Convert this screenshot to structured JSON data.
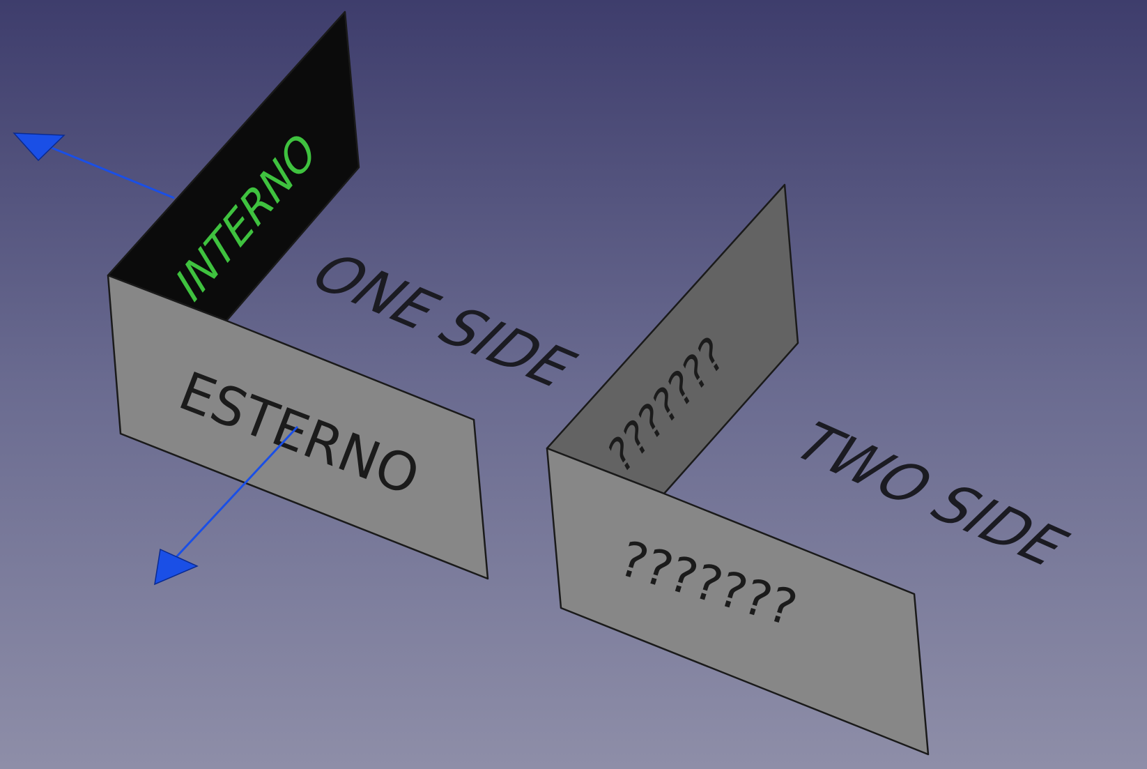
{
  "scene": {
    "background_top": "#3e3d6c",
    "background_bottom": "#8e8ea8",
    "arrow_color": "#1a4fe6",
    "one_side": {
      "title": "ONE SIDE",
      "inner_label": "INTERNO",
      "outer_label": "ESTERNO",
      "inner_face_color": "#0b0b0b",
      "outer_face_color": "#878787",
      "inner_label_color": "#3fc23f"
    },
    "two_side": {
      "title": "TWO SIDE",
      "inner_label": "???????",
      "outer_label": "???????",
      "inner_face_color": "#636363",
      "outer_face_color": "#878787"
    }
  }
}
